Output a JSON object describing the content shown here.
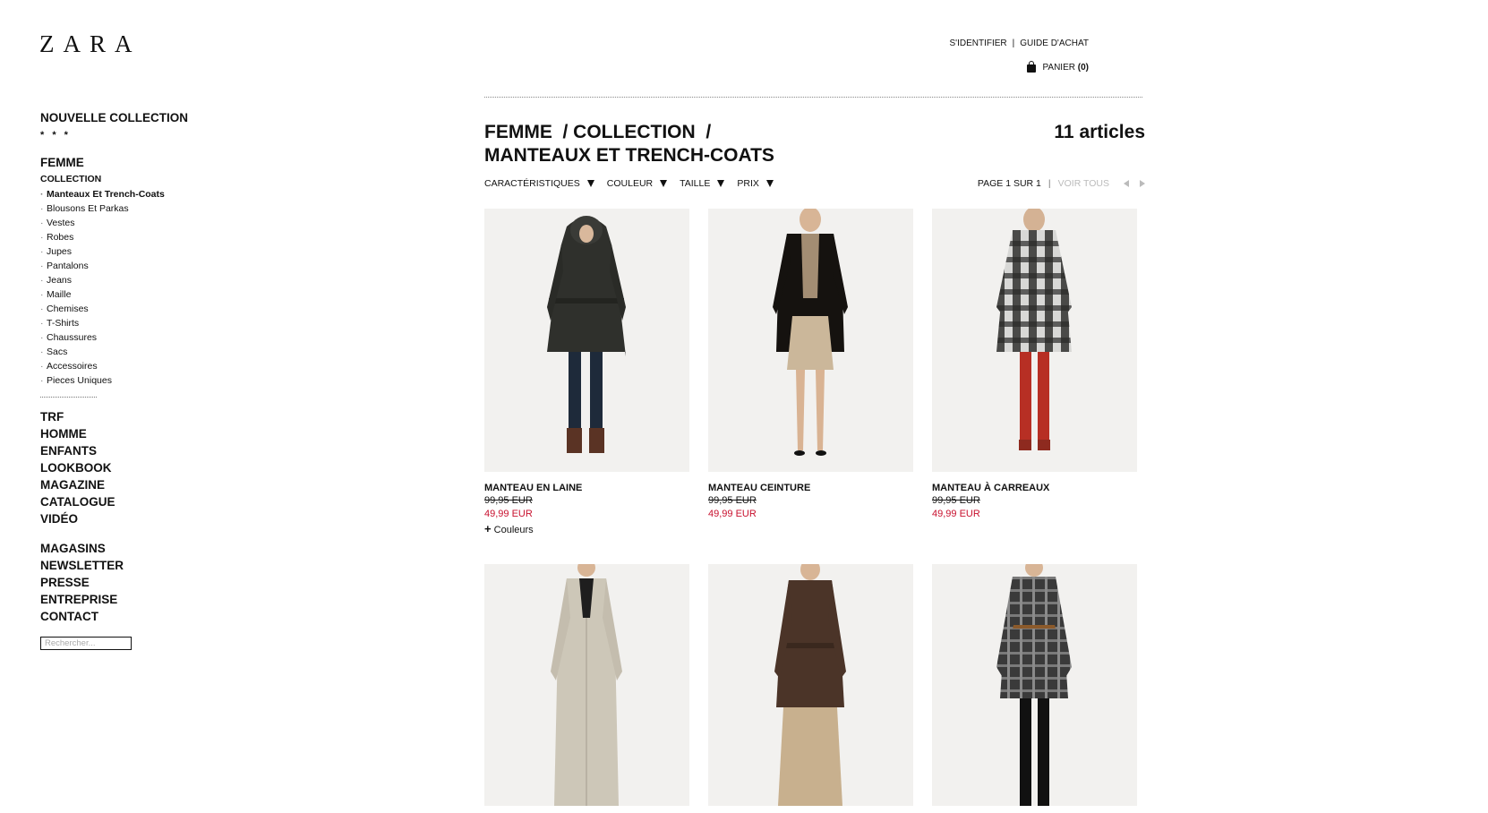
{
  "header": {
    "logo": "ZARA",
    "login": "S'IDENTIFIER",
    "separator": "|",
    "guide": "GUIDE D'ACHAT",
    "cart_label": "PANIER",
    "cart_count": "(0)"
  },
  "sidebar": {
    "nouvelle": "NOUVELLE COLLECTION",
    "stars": "* * *",
    "femme": "FEMME",
    "collection": "COLLECTION",
    "sub_items": [
      "Manteaux Et Trench-Coats",
      "Blousons Et Parkas",
      "Vestes",
      "Robes",
      "Jupes",
      "Pantalons",
      "Jeans",
      "Maille",
      "Chemises",
      "T-Shirts",
      "Chaussures",
      "Sacs",
      "Accessoires",
      "Pieces Uniques"
    ],
    "group2": [
      "TRF",
      "HOMME",
      "ENFANTS",
      "LOOKBOOK",
      "MAGAZINE",
      "CATALOGUE",
      "VIDÉO"
    ],
    "group3": [
      "MAGASINS",
      "NEWSLETTER",
      "PRESSE",
      "ENTREPRISE",
      "CONTACT"
    ],
    "search_placeholder": "Rechercher..."
  },
  "main": {
    "title_line1": "FEMME  / COLLECTION  /",
    "title_line2": "MANTEAUX ET TRENCH-COATS",
    "count": "11 articles",
    "filters": [
      "CARACTÉRISTIQUES",
      "COULEUR",
      "TAILLE",
      "PRIX"
    ],
    "page_info": "PAGE 1 SUR 1",
    "pager_sep": "|",
    "voir_tous": "VOIR TOUS"
  },
  "products": [
    {
      "name": "MANTEAU EN LAINE",
      "old_price": "99,95 EUR",
      "new_price": "49,99 EUR",
      "colors_plus": "+",
      "colors": "Couleurs"
    },
    {
      "name": "MANTEAU CEINTURE",
      "old_price": "99,95 EUR",
      "new_price": "49,99 EUR"
    },
    {
      "name": "MANTEAU À CARREAUX",
      "old_price": "99,95 EUR",
      "new_price": "49,99 EUR"
    }
  ],
  "colors": {
    "sale": "#c8102e",
    "text": "#111111",
    "muted": "#bbbbbb"
  }
}
